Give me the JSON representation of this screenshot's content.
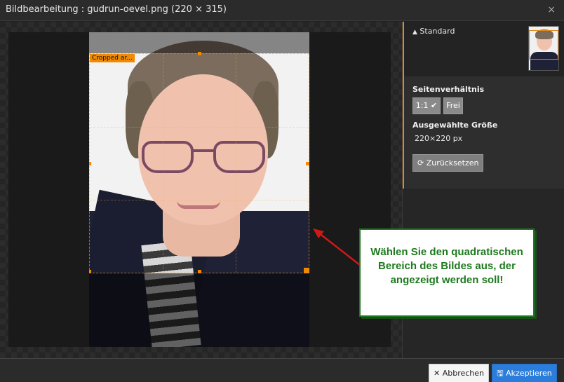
{
  "titlebar": {
    "title": "Bildbearbeitung : gudrun-oevel.png (220 × 315)",
    "close_glyph": "×"
  },
  "crop": {
    "label": "Cropped ar..."
  },
  "sidebar": {
    "preset": {
      "glyph": "▲",
      "label": "Standard"
    },
    "aspect_label": "Seitenverhältnis",
    "ratio_1_1": "1:1 ✔",
    "ratio_free": "Frei",
    "size_label": "Ausgewählte Größe",
    "size_value": "220×220 px",
    "reset": {
      "glyph": "⟳",
      "label": "Zurücksetzen"
    }
  },
  "footer": {
    "cancel": {
      "glyph": "✕",
      "label": "Abbrechen"
    },
    "accept": {
      "glyph": "🖫",
      "label": "Akzeptieren"
    }
  },
  "callout": {
    "text": "Wählen Sie den quadratischen Bereich des Bildes aus, der angezeigt werden soll!"
  },
  "colors": {
    "accent": "#e08a1c",
    "primary_button": "#2b7ddb",
    "callout_text": "#1e7a1e",
    "arrow": "#d01818"
  }
}
